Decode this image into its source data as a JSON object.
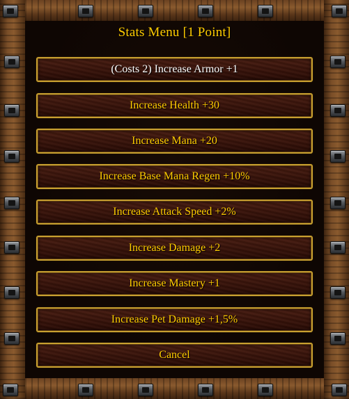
{
  "dialog": {
    "title": "Stats Menu [1 Point]",
    "buttons": [
      {
        "label": "(Costs 2) Increase Armor +1"
      },
      {
        "label": "Increase Health +30"
      },
      {
        "label": "Increase Mana +20"
      },
      {
        "label": "Increase Base Mana Regen +10%"
      },
      {
        "label": "Increase Attack Speed +2%"
      },
      {
        "label": "Increase Damage +2"
      },
      {
        "label": "Increase Mastery +1"
      },
      {
        "label": "Increase Pet Damage +1,5%"
      },
      {
        "label": "Cancel"
      }
    ]
  },
  "colors": {
    "text_gold": "#ffcc00",
    "text_white": "#ffffff",
    "button_border": "#c8a030",
    "button_fill": "#3a140b",
    "background": "#0e0603"
  }
}
